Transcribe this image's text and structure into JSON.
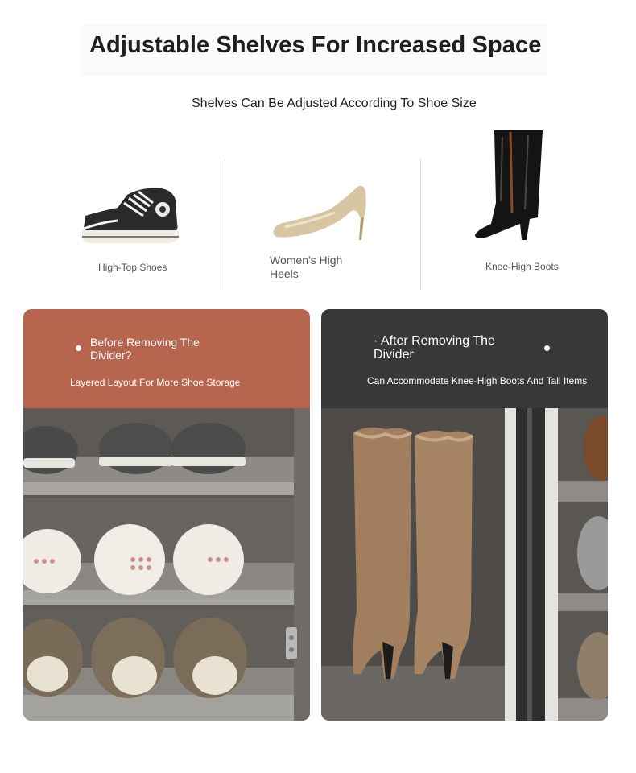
{
  "header": {
    "title": "Adjustable Shelves For Increased Space",
    "subtitle": "Shelves Can Be Adjusted According To Shoe Size"
  },
  "shoe_types": [
    {
      "label": "High-Top Shoes",
      "icon": "high-top-sneaker-icon"
    },
    {
      "label": "Women's High Heels",
      "icon": "high-heel-icon"
    },
    {
      "label": "Knee-High Boots",
      "icon": "knee-high-boot-icon"
    }
  ],
  "panels": {
    "before": {
      "title": "Before Removing The Divider?",
      "description": "Layered Layout For More Shoe Storage",
      "color": "#b7654e"
    },
    "after": {
      "title": "· After Removing The Divider",
      "description": "Can Accommodate Knee-High Boots And Tall Items",
      "color": "#383838"
    }
  }
}
